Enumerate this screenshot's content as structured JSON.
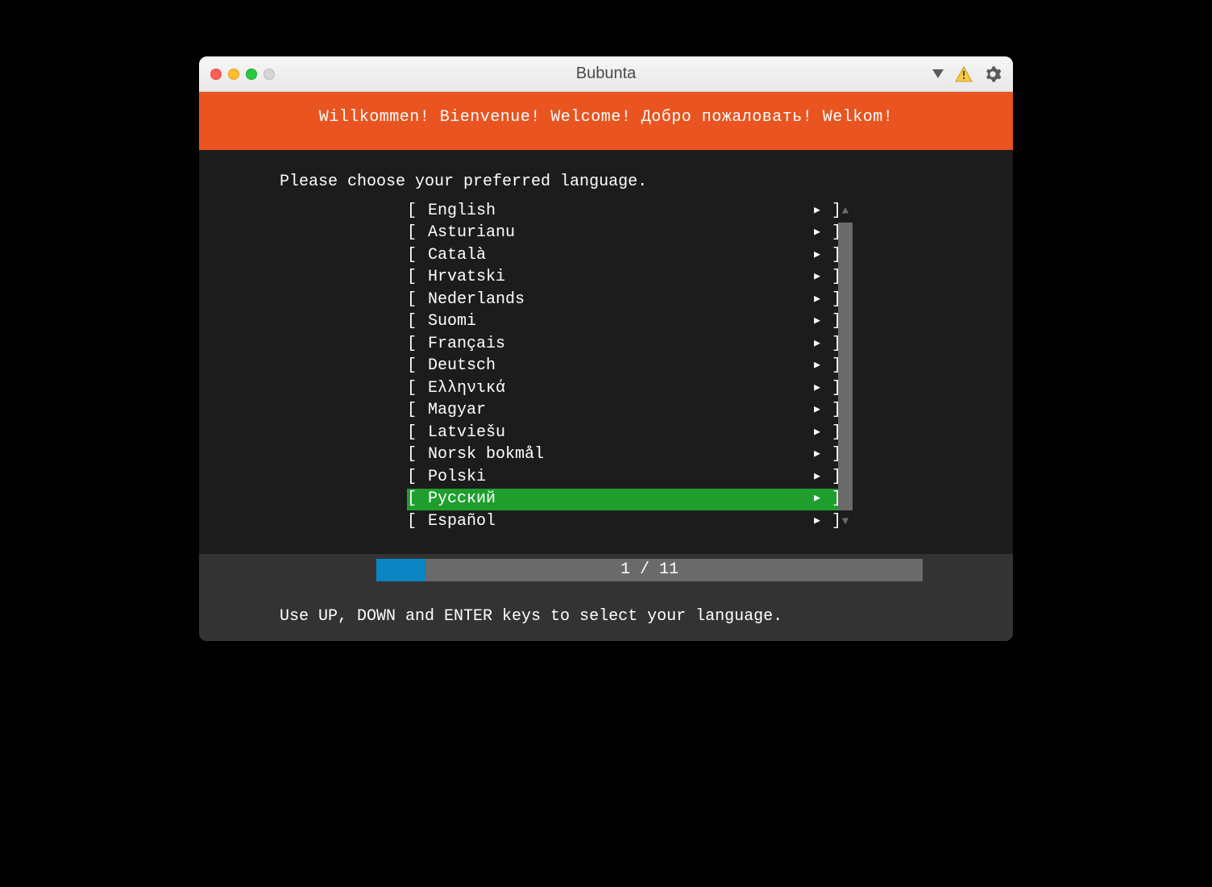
{
  "window": {
    "title": "Bubunta"
  },
  "banner": {
    "text": "Willkommen! Bienvenue! Welcome! Добро пожаловать! Welkom!"
  },
  "prompt": "Please choose your preferred language.",
  "languages": [
    {
      "name": "English",
      "selected": false
    },
    {
      "name": "Asturianu",
      "selected": false
    },
    {
      "name": "Català",
      "selected": false
    },
    {
      "name": "Hrvatski",
      "selected": false
    },
    {
      "name": "Nederlands",
      "selected": false
    },
    {
      "name": "Suomi",
      "selected": false
    },
    {
      "name": "Français",
      "selected": false
    },
    {
      "name": "Deutsch",
      "selected": false
    },
    {
      "name": "Ελληνικά",
      "selected": false
    },
    {
      "name": "Magyar",
      "selected": false
    },
    {
      "name": "Latviešu",
      "selected": false
    },
    {
      "name": "Norsk bokmål",
      "selected": false
    },
    {
      "name": "Polski",
      "selected": false
    },
    {
      "name": "Русский",
      "selected": true
    },
    {
      "name": "Español",
      "selected": false
    }
  ],
  "brackets": {
    "left": "[ ",
    "arrow": "▸",
    "right": " ]"
  },
  "scroll": {
    "up": "▲",
    "down": "▼"
  },
  "progress": {
    "current": 1,
    "total": 11,
    "text": "1 / 11",
    "percent": 9
  },
  "footer": "Use UP, DOWN and ENTER keys to select your language."
}
